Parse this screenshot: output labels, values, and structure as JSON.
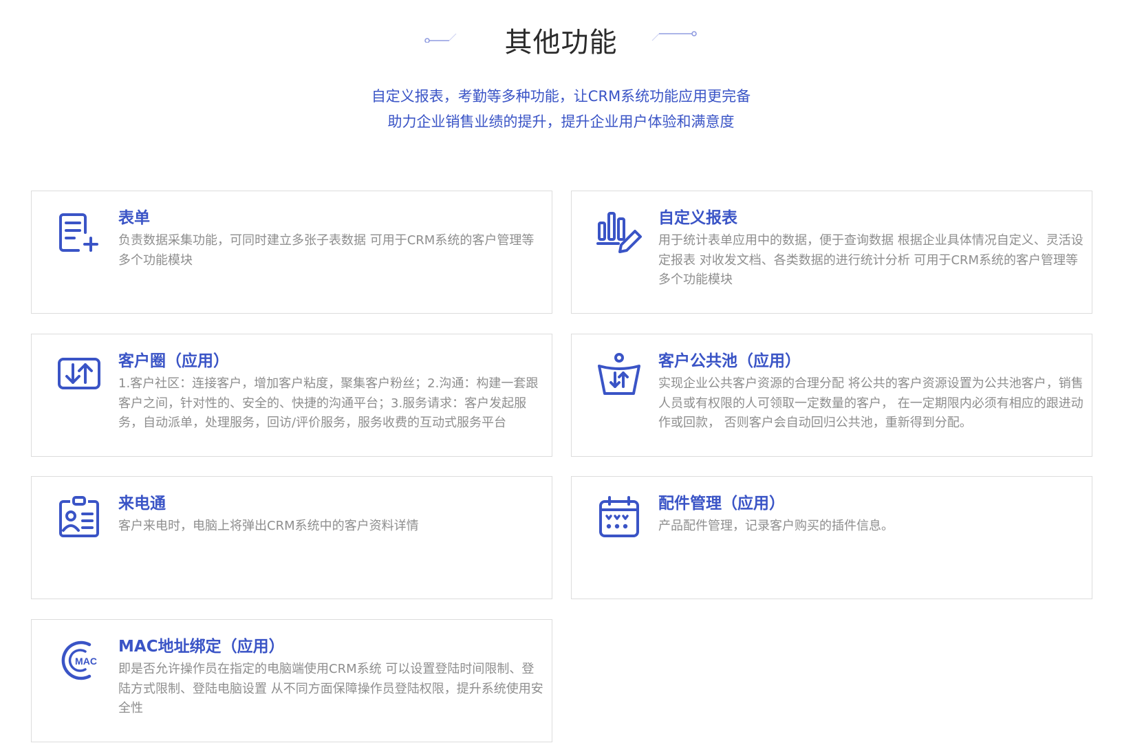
{
  "section": {
    "title": "其他功能",
    "subtitle_line1": "自定义报表，考勤等多种功能，让CRM系统功能应用更完备",
    "subtitle_line2": "助力企业销售业绩的提升，提升企业用户体验和满意度"
  },
  "colors": {
    "accent": "#3a54c6",
    "deco": "#8f9be0",
    "text_gray": "#8e8e8e",
    "border": "#dcdcdc"
  },
  "cards": [
    {
      "icon": "form-add-icon",
      "title": "表单",
      "desc": "负责数据采集功能，可同时建立多张子表数据 可用于CRM系统的客户管理等多个功能模块"
    },
    {
      "icon": "report-chart-edit-icon",
      "title": "自定义报表",
      "desc": "用于统计表单应用中的数据，便于查询数据 根据企业具体情况自定义、灵活设定报表 对收发文档、各类数据的进行统计分析 可用于CRM系统的客户管理等多个功能模块"
    },
    {
      "icon": "exchange-arrows-icon",
      "title": "客户圈（应用）",
      "desc": "1.客户社区：连接客户，增加客户粘度，聚集客户粉丝；2.沟通：构建一套跟客户之间，针对性的、安全的、快捷的沟通平台；3.服务请求：客户发起服务，自动派单，处理服务，回访/评价服务，服务收费的互动式服务平台"
    },
    {
      "icon": "public-pool-icon",
      "title": "客户公共池（应用）",
      "desc": "实现企业公共客户资源的合理分配 将公共的客户资源设置为公共池客户，销售人员或有权限的人可领取一定数量的客户， 在一定期限内必须有相应的跟进动作或回款， 否则客户会自动回归公共池，重新得到分配。"
    },
    {
      "icon": "caller-id-card-icon",
      "title": "来电通",
      "desc": "客户来电时，电脑上将弹出CRM系统中的客户资料详情"
    },
    {
      "icon": "calendar-parts-icon",
      "title": "配件管理（应用）",
      "desc": "产品配件管理，记录客户购买的插件信息。"
    },
    {
      "icon": "mac-address-icon",
      "title": "MAC地址绑定（应用）",
      "desc": "即是否允许操作员在指定的电脑端使用CRM系统 可以设置登陆时间限制、登陆方式限制、登陆电脑设置 从不同方面保障操作员登陆权限，提升系统使用安全性"
    }
  ]
}
